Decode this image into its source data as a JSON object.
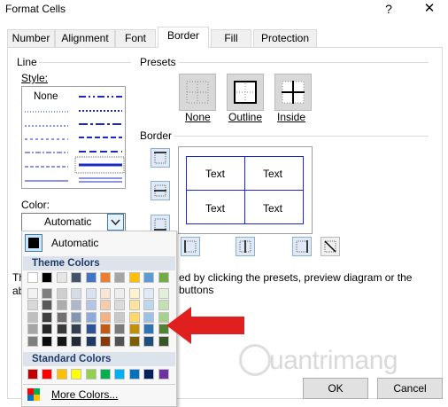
{
  "window": {
    "title": "Format Cells",
    "help_label": "?",
    "close_label": "✕"
  },
  "tabs": [
    {
      "label": "Number"
    },
    {
      "label": "Alignment"
    },
    {
      "label": "Font"
    },
    {
      "label": "Border"
    },
    {
      "label": "Fill"
    },
    {
      "label": "Protection"
    }
  ],
  "active_tab": "Border",
  "line": {
    "group_label": "Line",
    "style_label": "Style:",
    "none_label": "None",
    "color_label": "Color:",
    "color_value": "Automatic"
  },
  "presets": {
    "group_label": "Presets",
    "items": [
      {
        "label": "None"
      },
      {
        "label": "Outline"
      },
      {
        "label": "Inside"
      }
    ]
  },
  "border": {
    "group_label": "Border",
    "preview_cells": [
      "Text",
      "Text",
      "Text",
      "Text"
    ]
  },
  "description_fragments": {
    "left_line1": "Th",
    "left_line2": "ab",
    "right_line1": "ed by clicking the presets, preview diagram or the buttons"
  },
  "color_dropdown": {
    "automatic_label": "Automatic",
    "theme_header": "Theme Colors",
    "standard_header": "Standard Colors",
    "more_label": "More Colors...",
    "theme_rows": [
      [
        "#ffffff",
        "#000000",
        "#e7e6e6",
        "#44546a",
        "#4472c4",
        "#ed7d31",
        "#a5a5a5",
        "#ffc000",
        "#5b9bd5",
        "#70ad47"
      ],
      [
        "#f2f2f2",
        "#7f7f7f",
        "#d0cece",
        "#d6dce4",
        "#d9e2f3",
        "#fbe5d5",
        "#ededed",
        "#fff2cc",
        "#deebf6",
        "#e2efd9"
      ],
      [
        "#d8d8d8",
        "#595959",
        "#aeabab",
        "#adb9ca",
        "#b4c6e7",
        "#f7cbac",
        "#dbdbdb",
        "#fee599",
        "#bdd7ee",
        "#c5e0b3"
      ],
      [
        "#bfbfbf",
        "#3f3f3f",
        "#757070",
        "#8496b0",
        "#8eaadb",
        "#f4b183",
        "#c9c9c9",
        "#ffd965",
        "#9cc3e5",
        "#a8d08d"
      ],
      [
        "#a5a5a5",
        "#262626",
        "#3a3838",
        "#323f4f",
        "#2f5496",
        "#c45911",
        "#7b7b7b",
        "#bf9000",
        "#2e75b5",
        "#538135"
      ],
      [
        "#7f7f7f",
        "#0c0c0c",
        "#171616",
        "#222a35",
        "#1f3864",
        "#823b0b",
        "#525252",
        "#7f6000",
        "#1e4e79",
        "#375623"
      ]
    ],
    "standard_colors": [
      "#c00000",
      "#ff0000",
      "#ffc000",
      "#ffff00",
      "#92d050",
      "#00b050",
      "#00b0f0",
      "#0070c0",
      "#002060",
      "#7030a0"
    ]
  },
  "buttons": {
    "ok_label": "OK",
    "cancel_label": "Cancel"
  },
  "annotation": {
    "arrow_color": "#e01f1f"
  },
  "watermark": {
    "text": "uantrimang"
  }
}
